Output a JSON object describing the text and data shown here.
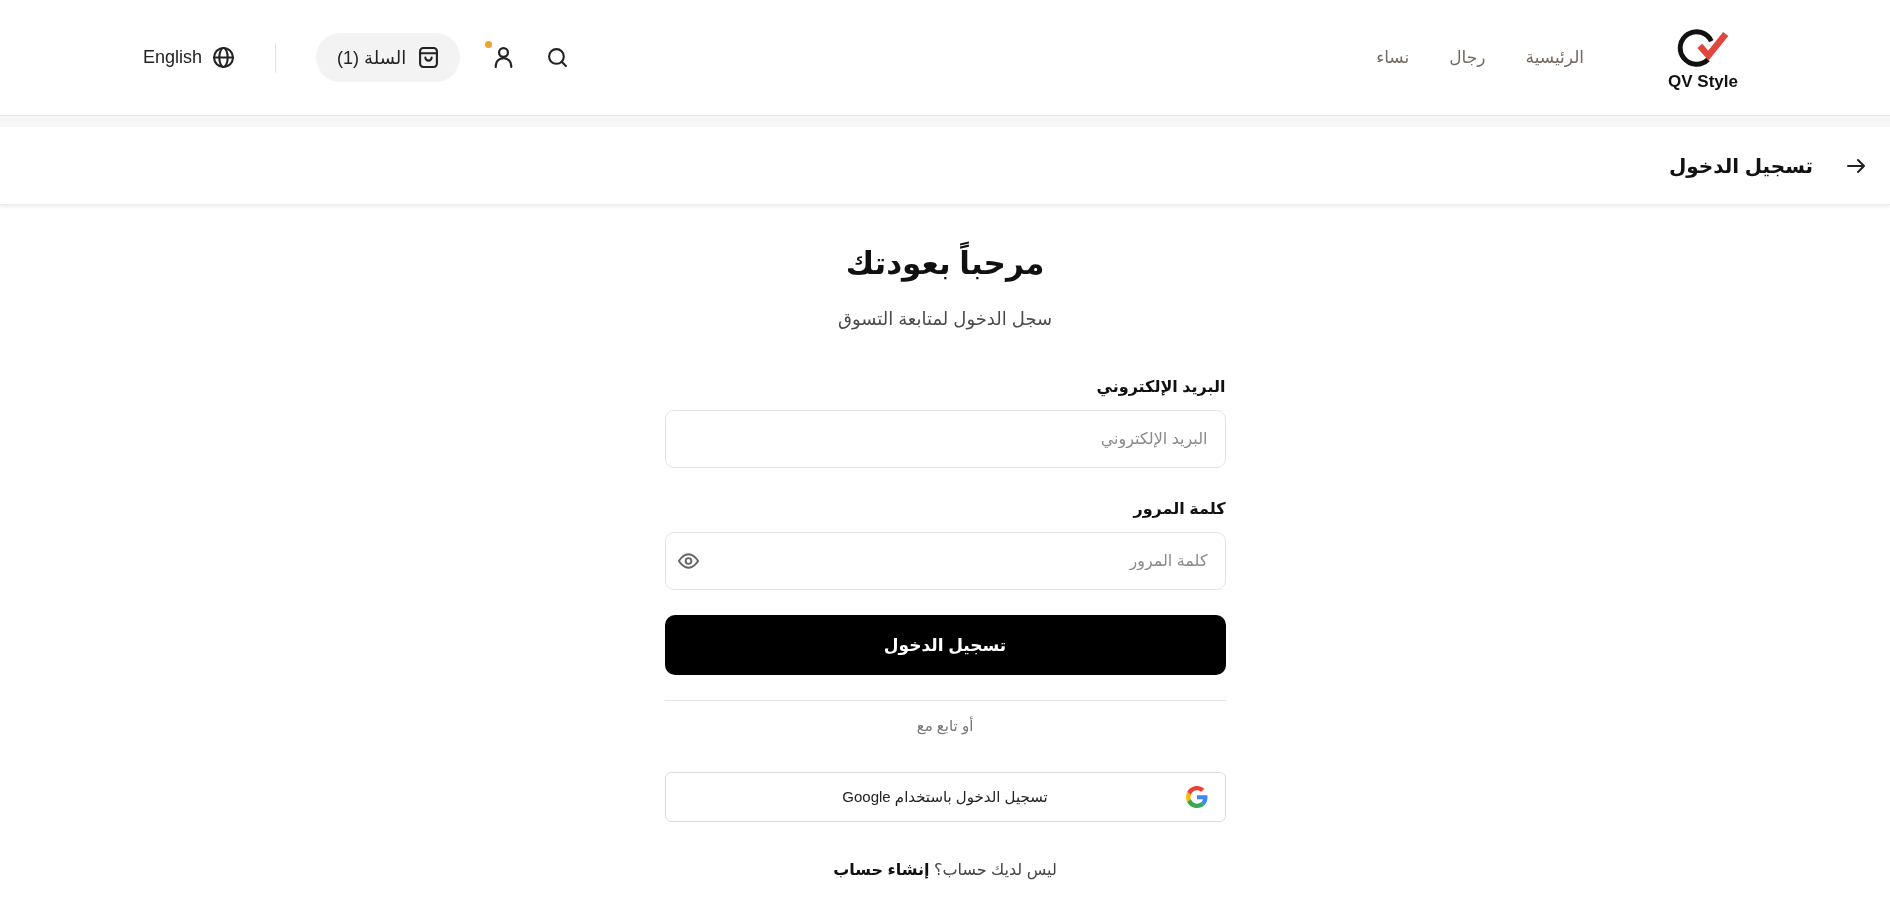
{
  "header": {
    "logo": {
      "text": "QV Style"
    },
    "nav": [
      {
        "label": "الرئيسية"
      },
      {
        "label": "رجال"
      },
      {
        "label": "نساء"
      }
    ],
    "account": {
      "has_notification": true
    },
    "cart": {
      "label": "السلة (1)"
    },
    "language": {
      "label": "English"
    }
  },
  "page_bar": {
    "title": "تسجيل الدخول"
  },
  "login": {
    "heading": "مرحباً بعودتك",
    "subtitle": "سجل الدخول لمتابعة التسوق",
    "fields": [
      {
        "kind": "email",
        "label": "البريد الإلكتروني",
        "placeholder": "البريد الإلكتروني"
      },
      {
        "kind": "password",
        "label": "كلمة المرور",
        "placeholder": "كلمة المرور"
      }
    ],
    "submit": "تسجيل الدخول",
    "divider_text": "أو تابع مع",
    "social": [
      {
        "kind": "google",
        "label": "تسجيل الدخول باستخدام Google"
      }
    ],
    "signup": {
      "text": "ليس لديك حساب؟",
      "link": "إنشاء حساب"
    }
  }
}
